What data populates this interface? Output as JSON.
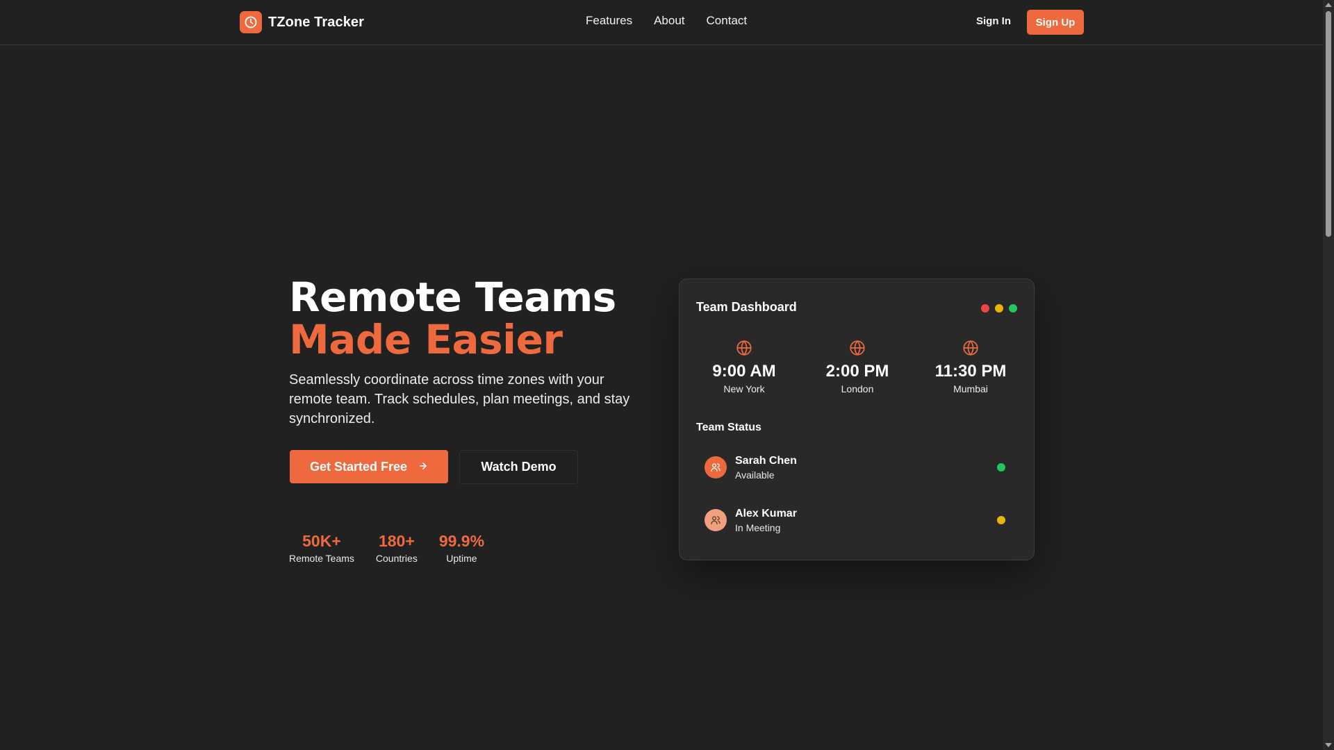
{
  "colors": {
    "accent": "#ee6a3e",
    "background": "#212121",
    "card": "#292929",
    "status_available": "#22c55e",
    "status_meeting": "#eab308",
    "traffic_red": "#ef4444",
    "traffic_yellow": "#eab308",
    "traffic_green": "#22c55e"
  },
  "header": {
    "brand": "TZone Tracker",
    "brand_icon": "clock-icon",
    "nav": [
      "Features",
      "About",
      "Contact"
    ],
    "sign_in": "Sign In",
    "sign_up": "Sign Up"
  },
  "hero": {
    "title_line1": "Remote Teams",
    "title_line2": "Made Easier",
    "subtitle": "Seamlessly coordinate across time zones with your remote team. Track schedules, plan meetings, and stay synchronized.",
    "primary_cta": "Get Started Free",
    "primary_cta_icon": "arrow-right-icon",
    "secondary_cta": "Watch Demo",
    "stats": [
      {
        "value": "50K+",
        "label": "Remote Teams"
      },
      {
        "value": "180+",
        "label": "Countries"
      },
      {
        "value": "99.9%",
        "label": "Uptime"
      }
    ]
  },
  "dashboard": {
    "title": "Team Dashboard",
    "clocks": [
      {
        "time": "9:00 AM",
        "city": "New York",
        "icon": "globe-icon"
      },
      {
        "time": "2:00 PM",
        "city": "London",
        "icon": "globe-icon"
      },
      {
        "time": "11:30 PM",
        "city": "Mumbai",
        "icon": "globe-icon"
      }
    ],
    "status_title": "Team Status",
    "members": [
      {
        "name": "Sarah Chen",
        "status": "Available",
        "icon": "users-icon"
      },
      {
        "name": "Alex Kumar",
        "status": "In Meeting",
        "icon": "users-icon"
      }
    ]
  }
}
